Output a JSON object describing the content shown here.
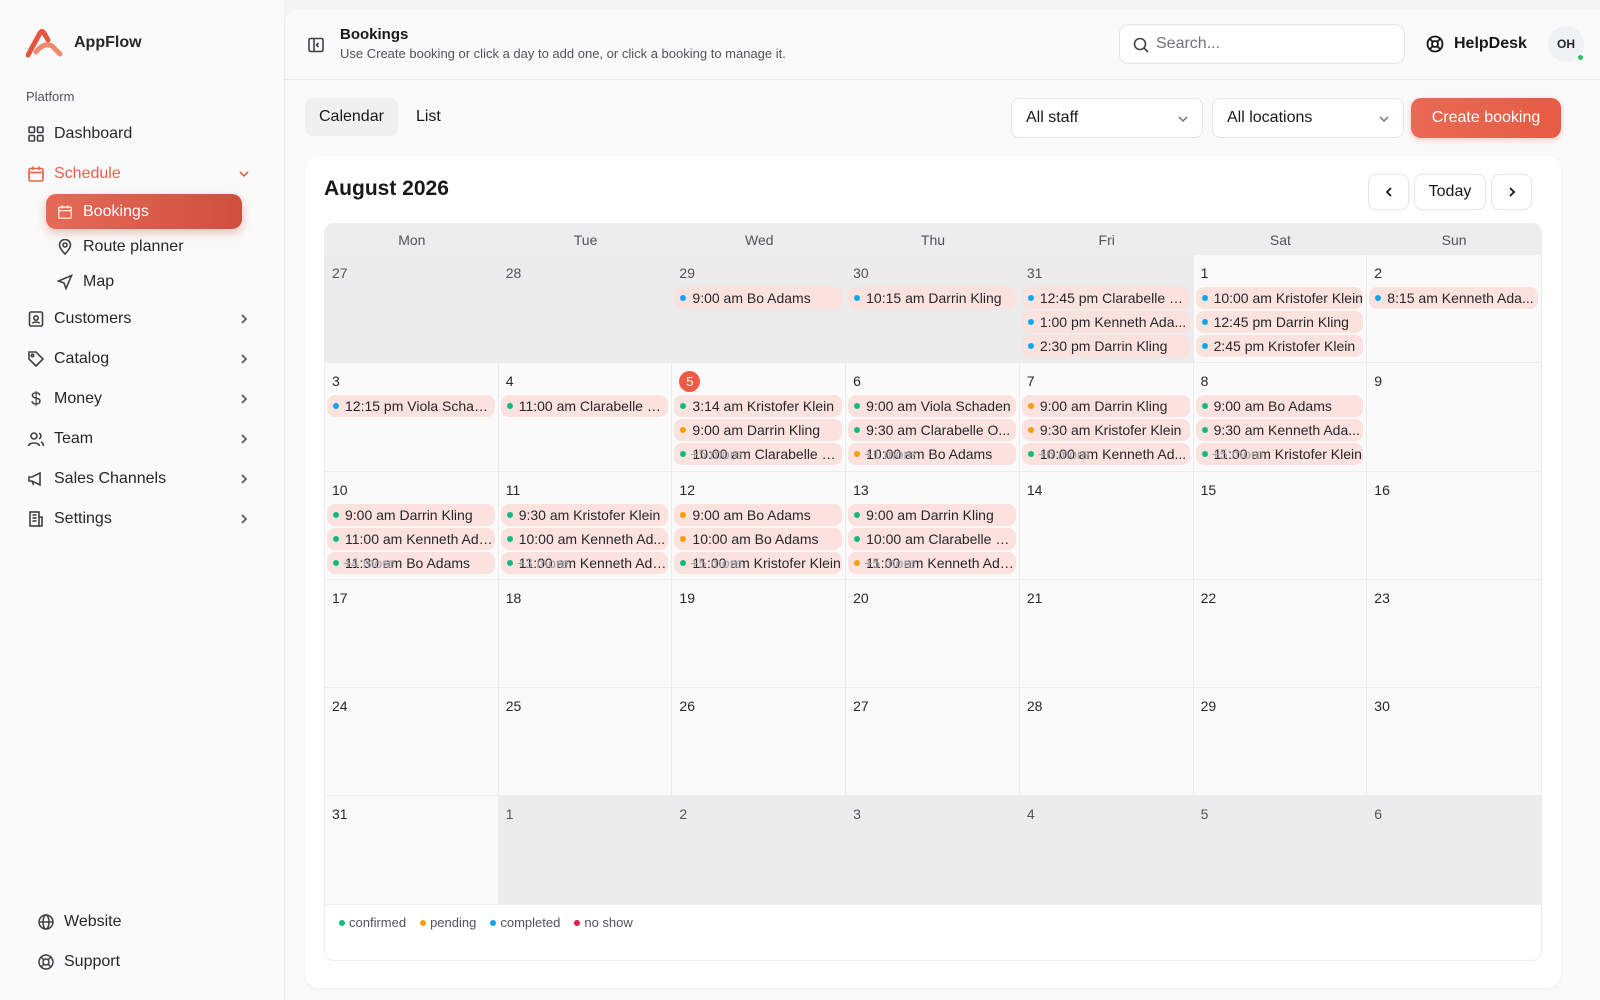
{
  "app": {
    "name": "AppFlow"
  },
  "sidebar": {
    "section_label": "Platform",
    "items": [
      {
        "label": "Dashboard",
        "icon": "grid-icon"
      },
      {
        "label": "Schedule",
        "icon": "calendar-icon"
      },
      {
        "label": "Customers",
        "icon": "id-card-icon"
      },
      {
        "label": "Catalog",
        "icon": "tag-icon"
      },
      {
        "label": "Money",
        "icon": "dollar-icon"
      },
      {
        "label": "Team",
        "icon": "users-icon"
      },
      {
        "label": "Sales Channels",
        "icon": "megaphone-icon"
      },
      {
        "label": "Settings",
        "icon": "building-icon"
      }
    ],
    "schedule_sub": [
      {
        "label": "Bookings",
        "icon": "calendar-icon"
      },
      {
        "label": "Route planner",
        "icon": "pin-icon"
      },
      {
        "label": "Map",
        "icon": "send-icon"
      }
    ],
    "bottom": [
      {
        "label": "Website",
        "icon": "globe-icon"
      },
      {
        "label": "Support",
        "icon": "lifebuoy-icon"
      }
    ]
  },
  "header": {
    "title": "Bookings",
    "subtitle": "Use Create booking or click a day to add one, or click a booking to manage it.",
    "search_placeholder": "Search...",
    "helpdesk": "HelpDesk",
    "avatar_initials": "OH"
  },
  "toolbar": {
    "tabs": [
      "Calendar",
      "List"
    ],
    "staff_filter": "All staff",
    "location_filter": "All locations",
    "create_label": "Create booking"
  },
  "calendar": {
    "month_title": "August 2026",
    "today_label": "Today",
    "weekdays": [
      "Mon",
      "Tue",
      "Wed",
      "Thu",
      "Fri",
      "Sat",
      "Sun"
    ],
    "status_colors": {
      "confirmed": "#10b981",
      "pending": "#f59e0b",
      "completed": "#0ea5e9",
      "no show": "#e11d48"
    },
    "legend": [
      "confirmed",
      "pending",
      "completed",
      "no show"
    ],
    "days": [
      {
        "n": "27",
        "outside": true,
        "events": []
      },
      {
        "n": "28",
        "outside": true,
        "events": []
      },
      {
        "n": "29",
        "outside": true,
        "events": [
          {
            "s": "completed",
            "t": "9:00 am Bo Adams"
          }
        ]
      },
      {
        "n": "30",
        "outside": true,
        "events": [
          {
            "s": "completed",
            "t": "10:15 am Darrin Kling"
          }
        ]
      },
      {
        "n": "31",
        "outside": true,
        "events": [
          {
            "s": "completed",
            "t": "12:45 pm Clarabelle O..."
          },
          {
            "s": "completed",
            "t": "1:00 pm Kenneth Ada..."
          },
          {
            "s": "completed",
            "t": "2:30 pm Darrin Kling"
          }
        ]
      },
      {
        "n": "1",
        "events": [
          {
            "s": "completed",
            "t": "10:00 am Kristofer Klein"
          },
          {
            "s": "completed",
            "t": "12:45 pm Darrin Kling"
          },
          {
            "s": "completed",
            "t": "2:45 pm Kristofer Klein"
          }
        ]
      },
      {
        "n": "2",
        "events": [
          {
            "s": "completed",
            "t": "8:15 am Kenneth Ada..."
          }
        ]
      },
      {
        "n": "3",
        "events": [
          {
            "s": "completed",
            "t": "12:15 pm Viola Schaden"
          }
        ]
      },
      {
        "n": "4",
        "events": [
          {
            "s": "confirmed",
            "t": "11:00 am Clarabelle O..."
          }
        ]
      },
      {
        "n": "5",
        "today": true,
        "more": "+5 more",
        "events": [
          {
            "s": "confirmed",
            "t": "3:14 am Kristofer Klein"
          },
          {
            "s": "pending",
            "t": "9:00 am Darrin Kling"
          },
          {
            "s": "confirmed",
            "t": "10:00 am Clarabelle O..."
          }
        ]
      },
      {
        "n": "6",
        "more": "+1 more",
        "events": [
          {
            "s": "confirmed",
            "t": "9:00 am Viola Schaden"
          },
          {
            "s": "confirmed",
            "t": "9:30 am Clarabelle O..."
          },
          {
            "s": "pending",
            "t": "10:00 am Bo Adams"
          }
        ]
      },
      {
        "n": "7",
        "more": "+6 more",
        "events": [
          {
            "s": "pending",
            "t": "9:00 am Darrin Kling"
          },
          {
            "s": "pending",
            "t": "9:30 am Kristofer Klein"
          },
          {
            "s": "confirmed",
            "t": "10:00 am Kenneth Ad..."
          }
        ]
      },
      {
        "n": "8",
        "more": "+5 more",
        "events": [
          {
            "s": "confirmed",
            "t": "9:00 am Bo Adams"
          },
          {
            "s": "confirmed",
            "t": "9:30 am Kenneth Ada..."
          },
          {
            "s": "confirmed",
            "t": "11:00 am Kristofer Klein"
          }
        ]
      },
      {
        "n": "9",
        "events": []
      },
      {
        "n": "10",
        "more": "+4 more",
        "events": [
          {
            "s": "confirmed",
            "t": "9:00 am Darrin Kling"
          },
          {
            "s": "confirmed",
            "t": "11:00 am Kenneth Ada..."
          },
          {
            "s": "confirmed",
            "t": "11:30 am Bo Adams"
          }
        ]
      },
      {
        "n": "11",
        "more": "+3 more",
        "events": [
          {
            "s": "confirmed",
            "t": "9:30 am Kristofer Klein"
          },
          {
            "s": "confirmed",
            "t": "10:00 am Kenneth Ad..."
          },
          {
            "s": "confirmed",
            "t": "11:00 am Kenneth Ada..."
          }
        ]
      },
      {
        "n": "12",
        "more": "+5 more",
        "events": [
          {
            "s": "pending",
            "t": "9:00 am Bo Adams"
          },
          {
            "s": "pending",
            "t": "10:00 am Bo Adams"
          },
          {
            "s": "confirmed",
            "t": "11:00 am Kristofer Klein"
          }
        ]
      },
      {
        "n": "13",
        "more": "+5 more",
        "events": [
          {
            "s": "confirmed",
            "t": "9:00 am Darrin Kling"
          },
          {
            "s": "confirmed",
            "t": "10:00 am Clarabelle O..."
          },
          {
            "s": "pending",
            "t": "11:00 am Kenneth Ada..."
          }
        ]
      },
      {
        "n": "14",
        "events": []
      },
      {
        "n": "15",
        "events": []
      },
      {
        "n": "16",
        "events": []
      },
      {
        "n": "17",
        "events": []
      },
      {
        "n": "18",
        "events": []
      },
      {
        "n": "19",
        "events": []
      },
      {
        "n": "20",
        "events": []
      },
      {
        "n": "21",
        "events": []
      },
      {
        "n": "22",
        "events": []
      },
      {
        "n": "23",
        "events": []
      },
      {
        "n": "24",
        "events": []
      },
      {
        "n": "25",
        "events": []
      },
      {
        "n": "26",
        "events": []
      },
      {
        "n": "27",
        "events": []
      },
      {
        "n": "28",
        "events": []
      },
      {
        "n": "29",
        "events": []
      },
      {
        "n": "30",
        "events": []
      },
      {
        "n": "31",
        "events": []
      },
      {
        "n": "1",
        "outside": true,
        "events": []
      },
      {
        "n": "2",
        "outside": true,
        "events": []
      },
      {
        "n": "3",
        "outside": true,
        "events": []
      },
      {
        "n": "4",
        "outside": true,
        "events": []
      },
      {
        "n": "5",
        "outside": true,
        "events": []
      },
      {
        "n": "6",
        "outside": true,
        "events": []
      }
    ]
  }
}
